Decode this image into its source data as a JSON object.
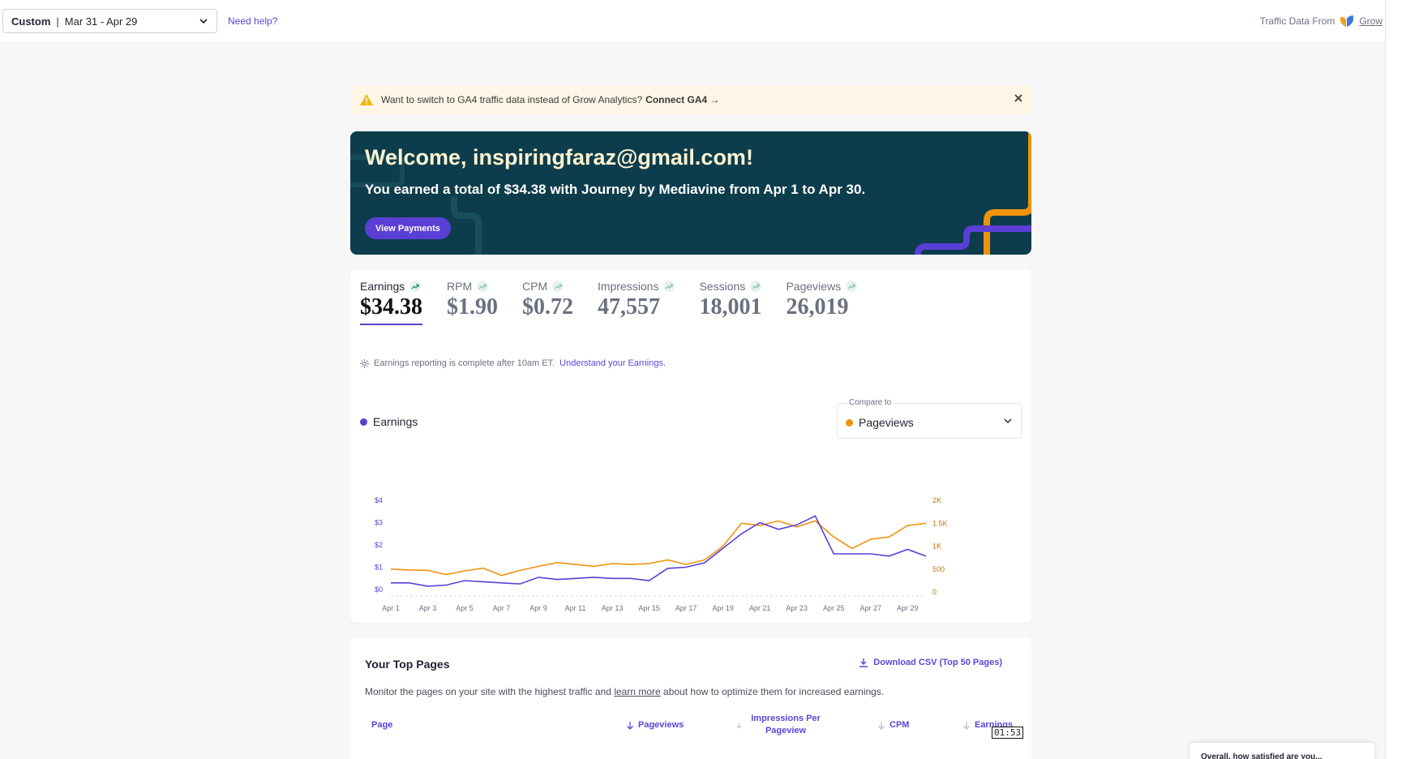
{
  "topbar": {
    "date_mode": "Custom",
    "date_range": "Mar 31 - Apr 29",
    "help_link": "Need help?",
    "traffic_label": "Traffic Data From",
    "traffic_source": "Grow"
  },
  "notice": {
    "text": "Want to switch to GA4 traffic data instead of Grow Analytics?",
    "link": "Connect GA4 →"
  },
  "banner": {
    "title": "Welcome, inspiringfaraz@gmail.com!",
    "subtitle": "You earned a total of $34.38 with Journey by Mediavine from Apr 1 to Apr 30.",
    "button": "View Payments"
  },
  "metrics": [
    {
      "label": "Earnings",
      "value": "$34.38",
      "active": true
    },
    {
      "label": "RPM",
      "value": "$1.90",
      "active": false
    },
    {
      "label": "CPM",
      "value": "$0.72",
      "active": false
    },
    {
      "label": "Impressions",
      "value": "47,557",
      "active": false
    },
    {
      "label": "Sessions",
      "value": "18,001",
      "active": false
    },
    {
      "label": "Pageviews",
      "value": "26,019",
      "active": false
    }
  ],
  "reporting": {
    "text": "Earnings reporting is complete after 10am ET.",
    "link": "Understand your Earnings."
  },
  "legend": {
    "primary": "Earnings"
  },
  "compare": {
    "caption": "Compare to",
    "value": "Pageviews"
  },
  "colors": {
    "earnings": "#5a3fd6",
    "pageviews": "#f0920c",
    "banner": "#0d3d4c",
    "accent": "#5b46d8"
  },
  "chart_data": {
    "type": "line",
    "x": [
      "Apr 1",
      "Apr 2",
      "Apr 3",
      "Apr 4",
      "Apr 5",
      "Apr 6",
      "Apr 7",
      "Apr 8",
      "Apr 9",
      "Apr 10",
      "Apr 11",
      "Apr 12",
      "Apr 13",
      "Apr 14",
      "Apr 15",
      "Apr 16",
      "Apr 17",
      "Apr 18",
      "Apr 19",
      "Apr 20",
      "Apr 21",
      "Apr 22",
      "Apr 23",
      "Apr 24",
      "Apr 25",
      "Apr 26",
      "Apr 27",
      "Apr 28",
      "Apr 29",
      "Apr 30"
    ],
    "x_ticks": [
      "Apr 1",
      "Apr 3",
      "Apr 5",
      "Apr 7",
      "Apr 9",
      "Apr 11",
      "Apr 13",
      "Apr 15",
      "Apr 17",
      "Apr 19",
      "Apr 21",
      "Apr 23",
      "Apr 25",
      "Apr 27",
      "Apr 29"
    ],
    "series": [
      {
        "name": "Earnings",
        "axis": "left",
        "values": [
          0.3,
          0.3,
          0.15,
          0.2,
          0.4,
          0.35,
          0.3,
          0.25,
          0.55,
          0.45,
          0.5,
          0.55,
          0.5,
          0.5,
          0.4,
          0.95,
          1.0,
          1.2,
          1.85,
          2.5,
          3.0,
          2.7,
          2.9,
          3.3,
          1.6,
          1.6,
          1.6,
          1.5,
          1.8,
          1.5
        ]
      },
      {
        "name": "Pageviews",
        "axis": "right",
        "values": [
          500,
          480,
          470,
          380,
          460,
          520,
          360,
          470,
          560,
          640,
          600,
          560,
          620,
          600,
          620,
          700,
          600,
          700,
          1000,
          1500,
          1450,
          1550,
          1420,
          1550,
          1200,
          950,
          1150,
          1200,
          1450,
          1500
        ]
      }
    ],
    "y_left_ticks": [
      "$0",
      "$1",
      "$2",
      "$3",
      "$4"
    ],
    "y_left_range": [
      0,
      4
    ],
    "y_right_ticks": [
      "0",
      "500",
      "1K",
      "1.5K",
      "2K"
    ],
    "y_right_range": [
      0,
      2000
    ],
    "legend": "top-left",
    "grid": false
  },
  "top_pages": {
    "title": "Your Top Pages",
    "download": "Download CSV (Top 50 Pages)",
    "desc_before": "Monitor the pages on your site with the highest traffic and",
    "desc_link": "learn more",
    "desc_after": "about how to optimize them for increased earnings.",
    "columns": [
      "Page",
      "Pageviews",
      "Impressions Per Pageview",
      "CPM",
      "Earnings"
    ]
  },
  "overlay": {
    "timer": "01:53",
    "survey": "Overall, how satisfied are you..."
  }
}
